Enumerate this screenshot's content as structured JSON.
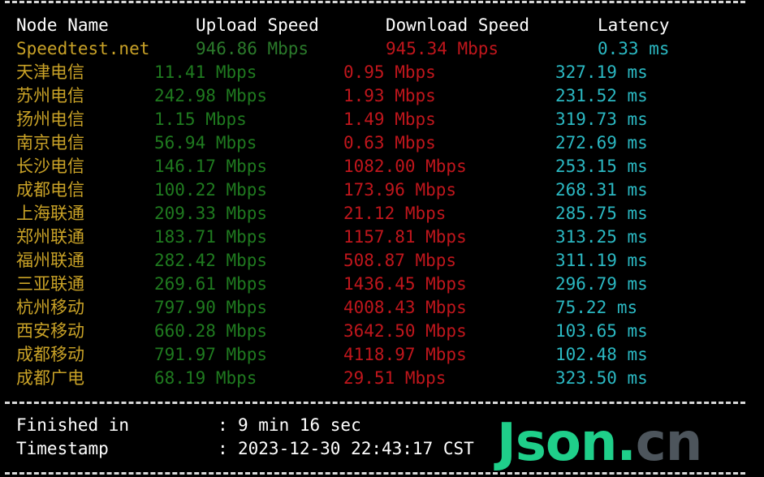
{
  "window": {
    "background": "#000000"
  },
  "colors": {
    "node_name": "#c9a227",
    "upload": "#1f7a1f",
    "download": "#c0161c",
    "latency": "#2bb8c2",
    "header": "#ffffff",
    "watermark_primary": "#1fcf8a",
    "watermark_secondary": "#4d555c"
  },
  "table": {
    "headers": {
      "node": "Node Name",
      "upload": "Upload Speed",
      "download": "Download Speed",
      "latency": "Latency"
    },
    "rows": [
      {
        "node": "Speedtest.net",
        "upload": "946.86 Mbps",
        "download": "945.34 Mbps",
        "latency": "0.33 ms"
      },
      {
        "node": "天津电信",
        "upload": "11.41 Mbps",
        "download": "0.95 Mbps",
        "latency": "327.19 ms"
      },
      {
        "node": "苏州电信",
        "upload": "242.98 Mbps",
        "download": "1.93 Mbps",
        "latency": "231.52 ms"
      },
      {
        "node": "扬州电信",
        "upload": "1.15 Mbps",
        "download": "1.49 Mbps",
        "latency": "319.73 ms"
      },
      {
        "node": "南京电信",
        "upload": "56.94 Mbps",
        "download": "0.63 Mbps",
        "latency": "272.69 ms"
      },
      {
        "node": "长沙电信",
        "upload": "146.17 Mbps",
        "download": "1082.00 Mbps",
        "latency": "253.15 ms"
      },
      {
        "node": "成都电信",
        "upload": "100.22 Mbps",
        "download": "173.96 Mbps",
        "latency": "268.31 ms"
      },
      {
        "node": "上海联通",
        "upload": "209.33 Mbps",
        "download": "21.12 Mbps",
        "latency": "285.75 ms"
      },
      {
        "node": "郑州联通",
        "upload": "183.71 Mbps",
        "download": "1157.81 Mbps",
        "latency": "313.25 ms"
      },
      {
        "node": "福州联通",
        "upload": "282.42 Mbps",
        "download": "508.87 Mbps",
        "latency": "311.19 ms"
      },
      {
        "node": "三亚联通",
        "upload": "269.61 Mbps",
        "download": "1436.45 Mbps",
        "latency": "296.79 ms"
      },
      {
        "node": "杭州移动",
        "upload": "797.90 Mbps",
        "download": "4008.43 Mbps",
        "latency": "75.22 ms"
      },
      {
        "node": "西安移动",
        "upload": "660.28 Mbps",
        "download": "3642.50 Mbps",
        "latency": "103.65 ms"
      },
      {
        "node": "成都移动",
        "upload": "791.97 Mbps",
        "download": "4118.97 Mbps",
        "latency": "102.48 ms"
      },
      {
        "node": "成都广电",
        "upload": "68.19 Mbps",
        "download": "29.51 Mbps",
        "latency": "323.50 ms"
      }
    ]
  },
  "footer": {
    "finished_label": "Finished in",
    "finished_value": "9 min 16 sec",
    "timestamp_label": "Timestamp",
    "timestamp_value": "2023-12-30 22:43:17 CST",
    "separator": ":"
  },
  "watermark": {
    "part1": "Json",
    "part2": ".",
    "part3": "cn"
  }
}
